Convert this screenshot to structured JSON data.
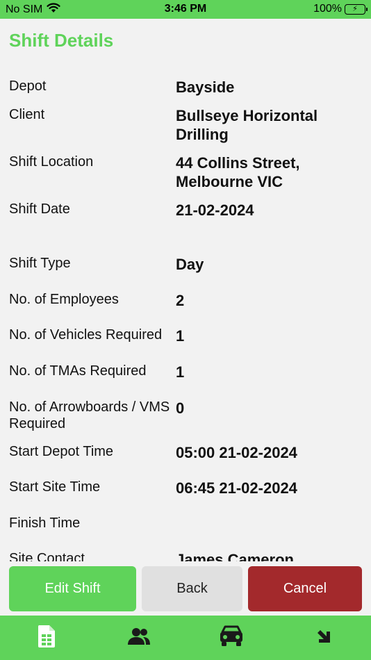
{
  "status_bar": {
    "carrier": "No SIM",
    "time": "3:46 PM",
    "battery": "100%"
  },
  "header": {
    "title": "Shift Details"
  },
  "details": [
    {
      "label": "Depot",
      "value": "Bayside"
    },
    {
      "label": "Client",
      "value": "Bullseye Horizontal Drilling"
    },
    {
      "label": "Shift Location",
      "value": "44 Collins Street, Melbourne VIC"
    },
    {
      "label": "Shift Date",
      "value": "21-02-2024"
    },
    {
      "label": "Shift Type",
      "value": "Day"
    },
    {
      "label": "No. of Employees",
      "value": "2"
    },
    {
      "label": "No. of Vehicles Required",
      "value": "1"
    },
    {
      "label": "No. of TMAs Required",
      "value": "1"
    },
    {
      "label": "No. of Arrowboards / VMS Required",
      "value": "0"
    },
    {
      "label": "Start Depot Time",
      "value": "05:00 21-02-2024"
    },
    {
      "label": "Start Site Time",
      "value": "06:45 21-02-2024"
    },
    {
      "label": "Finish Time",
      "value": ""
    },
    {
      "label": "Site Contact",
      "value": "James Cameron"
    }
  ],
  "actions": {
    "edit_label": "Edit Shift",
    "back_label": "Back",
    "cancel_label": "Cancel"
  },
  "tab_bar": {
    "items": [
      {
        "icon": "spreadsheet-icon"
      },
      {
        "icon": "people-icon"
      },
      {
        "icon": "car-icon"
      },
      {
        "icon": "arrow-down-right-icon"
      }
    ]
  },
  "colors": {
    "accent": "#5fd35a",
    "cancel": "#a3292c",
    "back": "#e0e0e0",
    "background": "#f2f2f2"
  }
}
